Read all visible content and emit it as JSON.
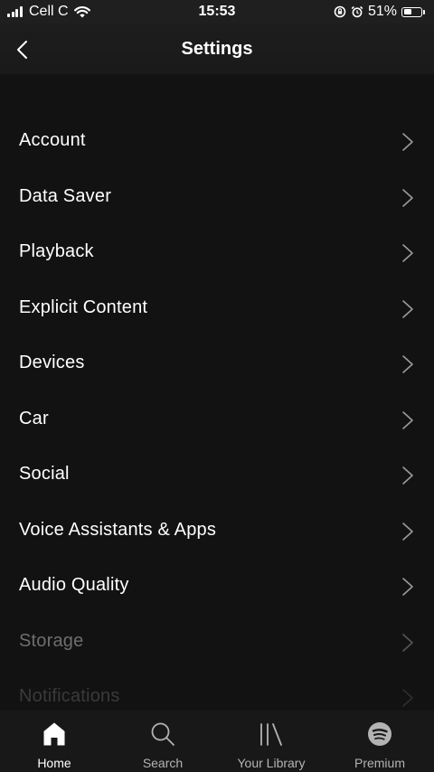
{
  "status_bar": {
    "carrier": "Cell C",
    "time": "15:53",
    "battery_percent": "51%",
    "battery_level": 0.51
  },
  "header": {
    "title": "Settings",
    "back_icon": "chevron-left-icon"
  },
  "settings": [
    {
      "label": "Account"
    },
    {
      "label": "Data Saver"
    },
    {
      "label": "Playback"
    },
    {
      "label": "Explicit Content"
    },
    {
      "label": "Devices"
    },
    {
      "label": "Car"
    },
    {
      "label": "Social"
    },
    {
      "label": "Voice Assistants & Apps"
    },
    {
      "label": "Audio Quality"
    },
    {
      "label": "Storage"
    },
    {
      "label": "Notifications"
    }
  ],
  "tabs": [
    {
      "label": "Home",
      "icon": "home-icon",
      "active": true
    },
    {
      "label": "Search",
      "icon": "search-icon",
      "active": false
    },
    {
      "label": "Your Library",
      "icon": "library-icon",
      "active": false
    },
    {
      "label": "Premium",
      "icon": "spotify-icon",
      "active": false
    }
  ],
  "colors": {
    "background": "#121212",
    "text": "#ffffff",
    "tab_inactive": "#b3b3b3"
  }
}
